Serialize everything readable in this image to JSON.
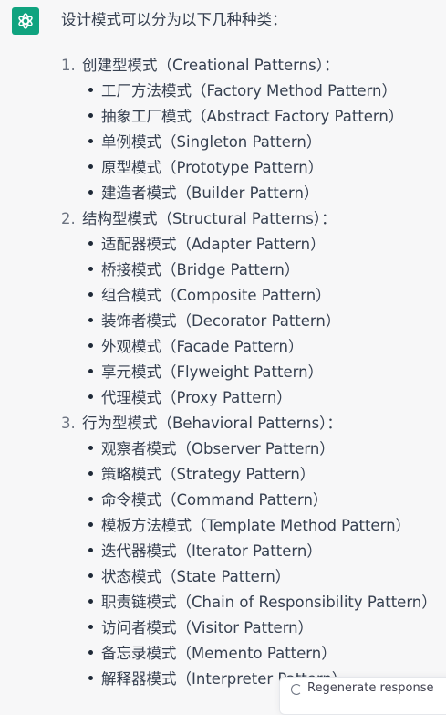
{
  "intro": "设计模式可以分为以下几种种类：",
  "categories": [
    {
      "number": "1.",
      "title": "创建型模式（Creational Patterns）：",
      "patterns": [
        "工厂方法模式（Factory Method Pattern）",
        "抽象工厂模式（Abstract Factory Pattern）",
        "单例模式（Singleton Pattern）",
        "原型模式（Prototype Pattern）",
        "建造者模式（Builder Pattern）"
      ]
    },
    {
      "number": "2.",
      "title": "结构型模式（Structural Patterns）：",
      "patterns": [
        "适配器模式（Adapter Pattern）",
        "桥接模式（Bridge Pattern）",
        "组合模式（Composite Pattern）",
        "装饰者模式（Decorator Pattern）",
        "外观模式（Facade Pattern）",
        "享元模式（Flyweight Pattern）",
        "代理模式（Proxy Pattern）"
      ]
    },
    {
      "number": "3.",
      "title": "行为型模式（Behavioral Patterns）：",
      "patterns": [
        "观察者模式（Observer Pattern）",
        "策略模式（Strategy Pattern）",
        "命令模式（Command Pattern）",
        "模板方法模式（Template Method Pattern）",
        "迭代器模式（Iterator Pattern）",
        "状态模式（State Pattern）",
        "职责链模式（Chain of Responsibility Pattern）",
        "访问者模式（Visitor Pattern）",
        "备忘录模式（Memento Pattern）",
        "解释器模式（Interpreter Pattern）"
      ]
    }
  ],
  "regenerate": {
    "label": "Regenerate response",
    "icon": "refresh-icon"
  },
  "avatar_icon": "openai-logo-icon",
  "colors": {
    "background": "#f7f7f8",
    "avatar": "#10a37f",
    "text": "#374151"
  }
}
